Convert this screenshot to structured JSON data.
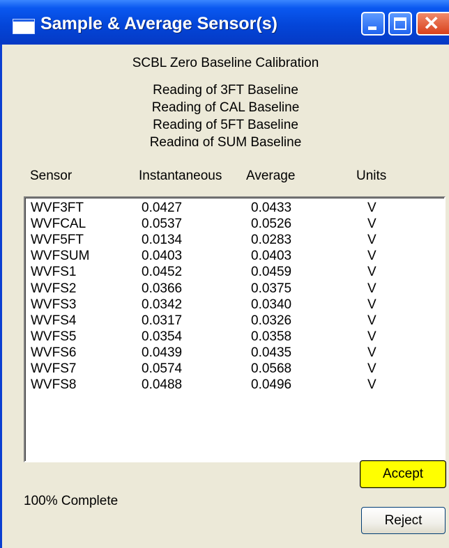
{
  "window": {
    "title": "Sample & Average Sensor(s)",
    "colors": {
      "titlebar": "#0446d9",
      "client": "#ece9d8",
      "accept_highlight": "#ffff00"
    }
  },
  "heading": "SCBL Zero Baseline Calibration",
  "readings": [
    "Reading of 3FT Baseline",
    "Reading of CAL Baseline",
    "Reading of 5FT Baseline",
    "Reading of SUM Baseline"
  ],
  "table": {
    "headers": {
      "sensor": "Sensor",
      "instantaneous": "Instantaneous",
      "average": "Average",
      "units": "Units"
    },
    "rows": [
      {
        "sensor": "WVF3FT",
        "instantaneous": "0.0427",
        "average": "0.0433",
        "units": "V"
      },
      {
        "sensor": "WVFCAL",
        "instantaneous": "0.0537",
        "average": "0.0526",
        "units": "V"
      },
      {
        "sensor": "WVF5FT",
        "instantaneous": "0.0134",
        "average": "0.0283",
        "units": "V"
      },
      {
        "sensor": "WVFSUM",
        "instantaneous": "0.0403",
        "average": "0.0403",
        "units": "V"
      },
      {
        "sensor": "WVFS1",
        "instantaneous": "0.0452",
        "average": "0.0459",
        "units": "V"
      },
      {
        "sensor": "WVFS2",
        "instantaneous": "0.0366",
        "average": "0.0375",
        "units": "V"
      },
      {
        "sensor": "WVFS3",
        "instantaneous": "0.0342",
        "average": "0.0340",
        "units": "V"
      },
      {
        "sensor": "WVFS4",
        "instantaneous": "0.0317",
        "average": "0.0326",
        "units": "V"
      },
      {
        "sensor": "WVFS5",
        "instantaneous": "0.0354",
        "average": "0.0358",
        "units": "V"
      },
      {
        "sensor": "WVFS6",
        "instantaneous": "0.0439",
        "average": "0.0435",
        "units": "V"
      },
      {
        "sensor": "WVFS7",
        "instantaneous": "0.0574",
        "average": "0.0568",
        "units": "V"
      },
      {
        "sensor": "WVFS8",
        "instantaneous": "0.0488",
        "average": "0.0496",
        "units": "V"
      }
    ]
  },
  "status": "100% Complete",
  "buttons": {
    "accept": "Accept",
    "reject": "Reject"
  },
  "icons": {
    "app": "window-icon",
    "minimize": "minimize-icon",
    "maximize": "maximize-icon",
    "close": "close-icon"
  }
}
